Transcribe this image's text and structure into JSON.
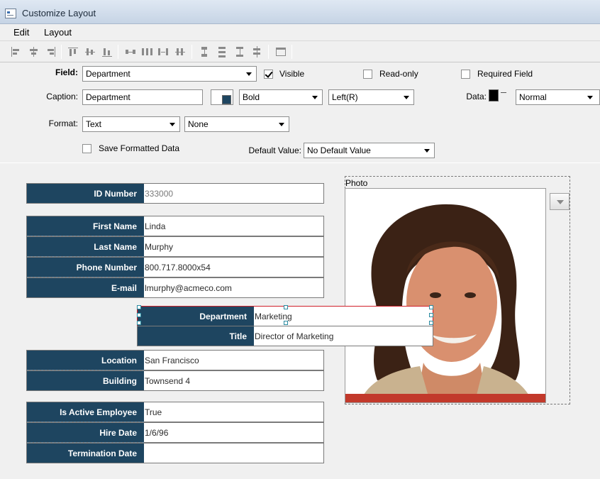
{
  "window": {
    "title": "Customize Layout"
  },
  "menu": {
    "items": [
      "Edit",
      "Layout"
    ]
  },
  "toolbar": {
    "icons": [
      "align-left-icon",
      "align-center-icon",
      "align-right-icon",
      "align-top-icon",
      "align-middle-icon",
      "align-bottom-icon",
      "space-horizontal-icon",
      "space-equal-horizontal-icon",
      "space-increase-horizontal-icon",
      "space-decrease-horizontal-icon",
      "space-vertical-icon",
      "space-equal-vertical-icon",
      "space-increase-vertical-icon",
      "space-decrease-vertical-icon",
      "tab-order-icon"
    ]
  },
  "properties": {
    "field_label": "Field:",
    "field_value": "Department",
    "visible_label": "Visible",
    "visible_checked": true,
    "readonly_label": "Read-only",
    "readonly_checked": false,
    "required_label": "Required Field",
    "required_checked": false,
    "caption_label": "Caption:",
    "caption_value": "Department",
    "caption_style": "Bold",
    "caption_align": "Left(R)",
    "data_label": "Data:",
    "data_style": "Normal",
    "format_label": "Format:",
    "format_value": "Text",
    "format_sub": "None",
    "save_formatted_label": "Save Formatted Data",
    "save_formatted_checked": false,
    "default_value_label": "Default Value:",
    "default_value": "No Default Value"
  },
  "form": {
    "id": {
      "label": "ID Number",
      "value": "333000"
    },
    "first_name": {
      "label": "First Name",
      "value": "Linda"
    },
    "last_name": {
      "label": "Last Name",
      "value": "Murphy"
    },
    "phone": {
      "label": "Phone Number",
      "value": "800.717.8000x54"
    },
    "email": {
      "label": "E-mail",
      "value": "lmurphy@acmeco.com"
    },
    "department": {
      "label": "Department",
      "value": "Marketing"
    },
    "title": {
      "label": "Title",
      "value": "Director of Marketing"
    },
    "location": {
      "label": "Location",
      "value": "San Francisco"
    },
    "building": {
      "label": "Building",
      "value": "Townsend 4"
    },
    "is_active": {
      "label": "Is Active Employee",
      "value": "True"
    },
    "hire_date": {
      "label": "Hire Date",
      "value": "1/6/96"
    },
    "termination": {
      "label": "Termination Date",
      "value": ""
    },
    "photo_label": "Photo"
  },
  "colors": {
    "caption_bg": "#1e4560",
    "selection_border": "#d0202a",
    "handle": "#2a8aa0"
  }
}
